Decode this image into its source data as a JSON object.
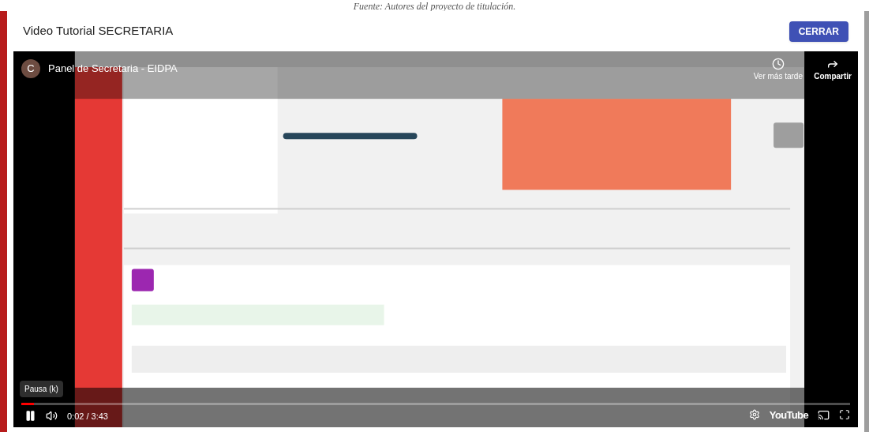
{
  "caption": "Fuente: Autores del proyecto de titulación.",
  "dialog": {
    "title": "Video Tutorial SECRETARIA",
    "close_button": "CERRAR"
  },
  "video": {
    "channel_initial": "C",
    "title": "Panel de Secretaria - EIDPA",
    "watch_later": "Ver más tarde",
    "share": "Compartir",
    "tooltip": "Pausa (k)",
    "progress": {
      "level": 0.015
    },
    "time": "0:02 / 3:43",
    "logo": "YouTube"
  }
}
